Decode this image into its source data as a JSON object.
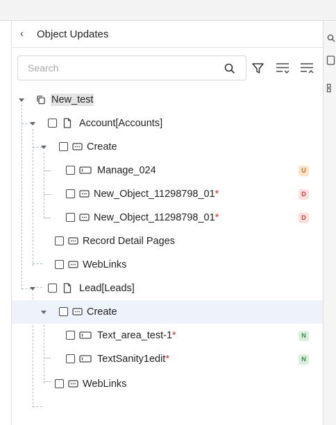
{
  "panel": {
    "back_icon": "chevron-left-icon",
    "title": "Object Updates"
  },
  "search": {
    "placeholder": "Search",
    "value": ""
  },
  "toolbar": {
    "icons": [
      "search-icon",
      "filter-icon",
      "expand-all-icon",
      "collapse-all-icon"
    ]
  },
  "colors": {
    "badge_update_bg": "#fde3c8",
    "badge_update_fg": "#c0692a",
    "badge_delete_bg": "#fbe0e0",
    "badge_delete_fg": "#c93a3a",
    "badge_new_bg": "#dcefdf",
    "badge_new_fg": "#2f8a45",
    "selected_row_bg": "#eef2fb",
    "required_star": "#d0312d"
  },
  "tree": {
    "root": {
      "label": "New_test",
      "icon": "copy-icon"
    },
    "account": {
      "label": "Account[Accounts]",
      "icon": "file-icon"
    },
    "account_create": {
      "label": "Create",
      "icon": "layout-icon"
    },
    "manage": {
      "label": "Manage_024",
      "icon": "input-field-icon",
      "badge": "U"
    },
    "new_object_1": {
      "label": "New_Object_11298798_01",
      "star": "*",
      "icon": "layout-icon",
      "badge": "D"
    },
    "new_object_2": {
      "label": "New_Object_11298798_01",
      "star": "*",
      "icon": "layout-icon",
      "badge": "D"
    },
    "record_detail": {
      "label": "Record Detail Pages",
      "icon": "layout-icon"
    },
    "weblinks_1": {
      "label": "WebLinks",
      "icon": "layout-icon"
    },
    "lead": {
      "label": "Lead[Leads]",
      "icon": "file-icon"
    },
    "lead_create": {
      "label": "Create",
      "icon": "layout-icon"
    },
    "text_area": {
      "label": "Text_area_test-1",
      "star": "*",
      "icon": "input-field-icon",
      "badge": "N"
    },
    "text_sanity": {
      "label": "TextSanity1edit",
      "star": "*",
      "icon": "input-field-icon",
      "badge": "N"
    },
    "weblinks_2": {
      "label": "WebLinks",
      "icon": "layout-icon"
    }
  }
}
